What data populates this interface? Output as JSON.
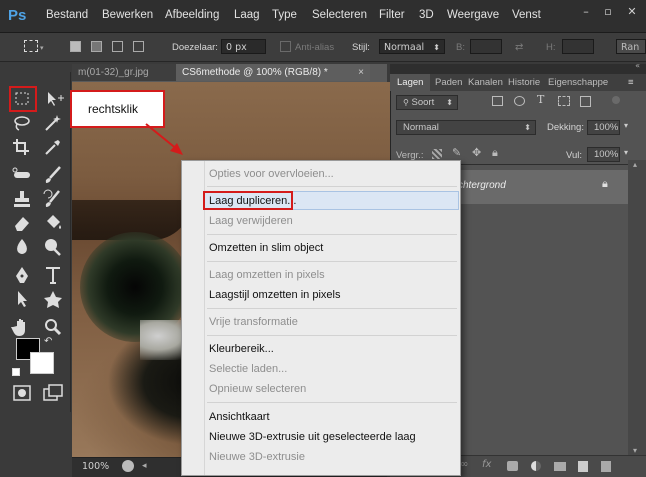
{
  "app": {
    "logo": "Ps",
    "menus": [
      "Bestand",
      "Bewerken",
      "Afbeelding",
      "Laag",
      "Type",
      "Selecteren",
      "Filter",
      "3D",
      "Weergave",
      "Venst"
    ],
    "window_controls": [
      "–",
      "▫",
      "✕"
    ]
  },
  "options_bar": {
    "feather_label": "Doezelaar:",
    "feather_value": "0 px",
    "antialias_label": "Anti-alias",
    "style_label": "Stijl:",
    "style_value": "Normaal",
    "width_label": "B:",
    "height_label": "H:",
    "refine_label": "Ran"
  },
  "document_tabs": [
    {
      "label": "m(01-32)_gr.jpg",
      "active": false
    },
    {
      "label": "CS6methode @ 100% (RGB/8) *",
      "active": true
    }
  ],
  "callout": {
    "text": "rechtsklik"
  },
  "status": {
    "zoom": "100%"
  },
  "layers_panel": {
    "tabs": [
      "Lagen",
      "Paden",
      "Kanalen",
      "Historie",
      "Eigenschappe"
    ],
    "filter_label": "Soort",
    "blend_mode": "Normaal",
    "opacity_label": "Dekking:",
    "opacity_value": "100%",
    "lock_label": "Vergr.:",
    "fill_label": "Vul:",
    "fill_value": "100%",
    "layer_name": "chtergrond"
  },
  "context_menu": {
    "items": [
      {
        "label": "Opties voor overvloeien...",
        "disabled": true
      },
      {
        "label": "Laag dupliceren...",
        "disabled": false,
        "highlighted": true
      },
      {
        "label": "Laag verwijderen",
        "disabled": true
      },
      {
        "label": "Omzetten in slim object",
        "disabled": false
      },
      {
        "label": "Laag omzetten in pixels",
        "disabled": true
      },
      {
        "label": "Laagstijl omzetten in pixels",
        "disabled": false
      },
      {
        "label": "Vrije transformatie",
        "disabled": true
      },
      {
        "label": "Kleurbereik...",
        "disabled": false
      },
      {
        "label": "Selectie laden...",
        "disabled": true
      },
      {
        "label": "Opnieuw selecteren",
        "disabled": true
      },
      {
        "label": "Ansichtkaart",
        "disabled": false
      },
      {
        "label": "Nieuwe 3D-extrusie uit geselecteerde laag",
        "disabled": false
      },
      {
        "label": "Nieuwe 3D-extrusie",
        "disabled": true
      }
    ]
  },
  "colors": {
    "accent_red": "#d41b1b",
    "ps_blue": "#4fa3e6",
    "menu_bg": "#ececec"
  }
}
